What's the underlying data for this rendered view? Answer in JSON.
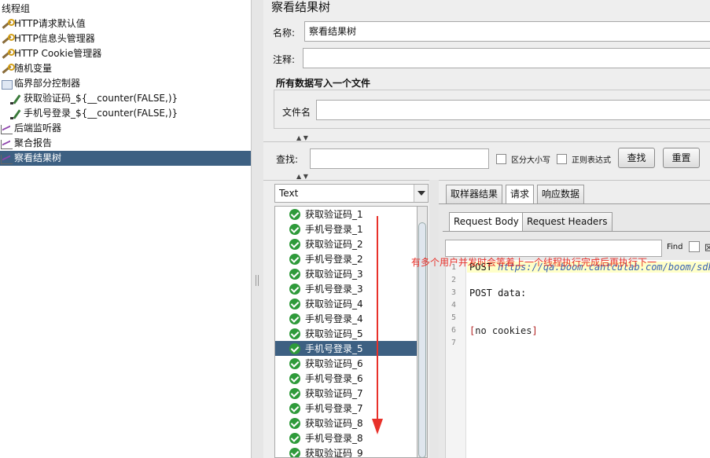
{
  "tree": {
    "items": [
      {
        "label": "线程组",
        "icon": "none",
        "indent": 0
      },
      {
        "label": "HTTP请求默认值",
        "icon": "wrench-icon"
      },
      {
        "label": "HTTP信息头管理器",
        "icon": "wrench-icon"
      },
      {
        "label": "HTTP Cookie管理器",
        "icon": "wrench-icon"
      },
      {
        "label": "随机变量",
        "icon": "wrench-icon"
      },
      {
        "label": "临界部分控制器",
        "icon": "controller-icon"
      },
      {
        "label": "获取验证码_${__counter(FALSE,)}",
        "icon": "pen-icon"
      },
      {
        "label": "手机号登录_${__counter(FALSE,)}",
        "icon": "pen-icon"
      },
      {
        "label": "后端监听器",
        "icon": "chart-icon"
      },
      {
        "label": "聚合报告",
        "icon": "chart-icon"
      },
      {
        "label": "察看结果树",
        "icon": "chart-icon",
        "selected": true
      }
    ]
  },
  "panel": {
    "title": "察看结果树",
    "name_label": "名称:",
    "name_value": "察看结果树",
    "comment_label": "注释:",
    "comment_value": "",
    "file_group_title": "所有数据写入一个文件",
    "filename_label": "文件名",
    "filename_value": "",
    "search_label": "查找:",
    "search_value": "",
    "case_sensitive_label": "区分大小写",
    "regex_label": "正则表达式",
    "find_button": "查找",
    "reset_button": "重置"
  },
  "renderer": {
    "selected": "Text"
  },
  "results": [
    {
      "label": "获取验证码_1"
    },
    {
      "label": "手机号登录_1"
    },
    {
      "label": "获取验证码_2"
    },
    {
      "label": "手机号登录_2"
    },
    {
      "label": "获取验证码_3"
    },
    {
      "label": "手机号登录_3"
    },
    {
      "label": "获取验证码_4"
    },
    {
      "label": "手机号登录_4"
    },
    {
      "label": "获取验证码_5"
    },
    {
      "label": "手机号登录_5",
      "selected": true
    },
    {
      "label": "获取验证码_6"
    },
    {
      "label": "手机号登录_6"
    },
    {
      "label": "获取验证码_7"
    },
    {
      "label": "手机号登录_7"
    },
    {
      "label": "获取验证码_8"
    },
    {
      "label": "手机号登录_8"
    },
    {
      "label": "获取验证码_9"
    }
  ],
  "tabs": {
    "sampler_result": "取样器结果",
    "request": "请求",
    "response_data": "响应数据",
    "active": "request"
  },
  "subtabs": {
    "request_body": "Request Body",
    "request_headers": "Request Headers",
    "active": "request_body"
  },
  "find": {
    "value": "",
    "label": "Find",
    "extra": "区"
  },
  "editor": {
    "line_numbers": [
      "1",
      "2",
      "3",
      "4",
      "5",
      "6",
      "7"
    ],
    "line1_method": "POST ",
    "line1_url": "https://qa.boom.cantculab.com/boom/sdk/",
    "line3": "POST data:",
    "line6_open": "[",
    "line6_text": "no cookies",
    "line6_close": "]"
  },
  "annotation": {
    "note": "有多个用户并发时会等着上一个线程执行完成后再执行下一",
    "color": "#e8312a"
  },
  "colors": {
    "selection": "#3d6082",
    "success": "#2e9a3a"
  }
}
